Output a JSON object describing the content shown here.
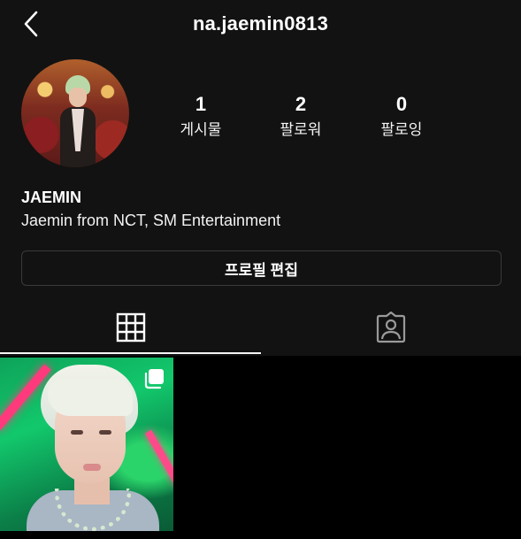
{
  "header": {
    "back_icon": "chevron-left-icon",
    "username": "na.jaemin0813"
  },
  "stats": {
    "posts": {
      "count": "1",
      "label": "게시물"
    },
    "followers": {
      "count": "2",
      "label": "팔로워"
    },
    "following": {
      "count": "0",
      "label": "팔로잉"
    }
  },
  "profile": {
    "display_name": "JAEMIN",
    "bio": "Jaemin from NCT, SM Entertainment"
  },
  "edit_button": {
    "label": "프로필 편집"
  },
  "tabs": [
    {
      "icon": "grid-icon",
      "active": true
    },
    {
      "icon": "tagged-person-icon",
      "active": false
    }
  ],
  "posts": [
    {
      "icon": "multiple-photos-icon"
    }
  ],
  "colors": {
    "background": "#121212",
    "text": "#ffffff",
    "border": "#3a3a3a"
  }
}
